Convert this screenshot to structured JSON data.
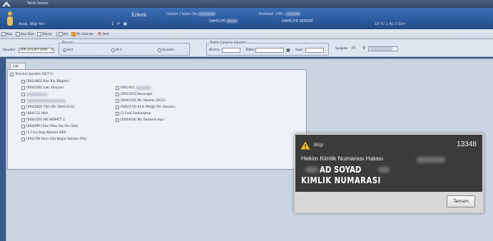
{
  "window": {
    "title": "Tahlil İstemi"
  },
  "header": {
    "user_name": "Aşağ. Bilgi Yeri",
    "center_label": "Erkek",
    "fields": [
      {
        "label": "Doktor / İşlem No",
        "value": "DAHİLİYE"
      },
      {
        "label": "Protokol: 236 /",
        "value": "DAHİLİYE SERVİSİ"
      }
    ],
    "age": "18 Yıl 1 Ay 2 Gün"
  },
  "toolbar": {
    "buttons": [
      "Kaz",
      "Kaş Ekle",
      "Tekrar",
      "Kili",
      "Ön Hazırla",
      "Yeni"
    ]
  },
  "filters": {
    "panel_label": "Paneller",
    "panel_value": "APP SİTEM FORM",
    "durum_label": "Durum",
    "radios": [
      "Acil",
      "Acil",
      "Sıradan"
    ],
    "date_group_label": "Tetkik Çalışma Süreleri",
    "date_from_label": "Birime",
    "date_to_label": "Tetkik",
    "date_extra_label": "Saat",
    "search_label": "Sorgula",
    "search_value": "PT"
  },
  "tab_label": "Lab",
  "panel": {
    "header": "Tümünü İşaretle (SET 1)",
    "left_items": [
      "[001/085] Kan Biy. Bilgileri",
      "[004/246] Lab. Dosyası",
      "",
      "",
      "[004/282] TSH (Ön Tahlil ECG)",
      "[004/11] HbA",
      "[004/350] HB HEMATT 1",
      "[004/PPF] Kan Pilas Yaş (ön Göz)",
      "[1 Fsıv] Kap Kibrıtal SIRS",
      "[001/79] İdrar Göz Bilgisi Kalıtım (Tst)"
    ],
    "right_items": [
      "[001/45]",
      "[001/153] Karaciğer",
      "[004/220] ML Alkaller (ECG)",
      "[001/173] Kırık Metgil Tst. Dosyası",
      "[1 Fsd] Farklılaşma",
      "[004/618] ML Tamamlı Aşırı"
    ]
  },
  "notification": {
    "title": "Bilgi",
    "code": "13348",
    "message": "Hekim Kimlik Numarası Hatası",
    "name": "AD SOYAD",
    "id_label": "KIMLIK NUMARASI",
    "button": "Tamam"
  }
}
